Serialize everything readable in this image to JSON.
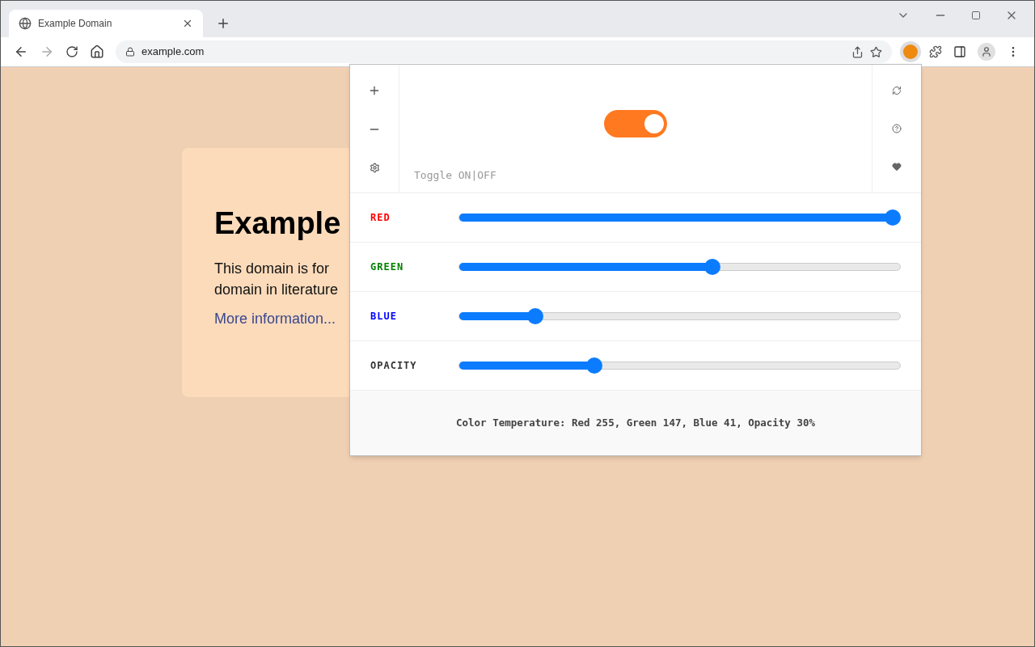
{
  "browser": {
    "tab": {
      "title": "Example Domain",
      "selected": true
    },
    "address": "example.com"
  },
  "page": {
    "heading": "Example",
    "lines": [
      "This domain is for",
      "domain in literature"
    ],
    "link": "More information..."
  },
  "popup": {
    "toggle": {
      "on": true,
      "label": "Toggle ON|OFF"
    },
    "sliders": [
      {
        "label": "RED",
        "color": "#ff0000",
        "level": 1
      },
      {
        "label": "GREEN",
        "color": "#008000",
        "level": 0.576
      },
      {
        "label": "BLUE",
        "color": "#0000ff",
        "level": 0.161
      },
      {
        "label": "OPACITY",
        "color": "#333333",
        "level": 0.3
      }
    ],
    "footer": "Color Temperature: Red 255, Green 147, Blue 41, Opacity 30%"
  }
}
